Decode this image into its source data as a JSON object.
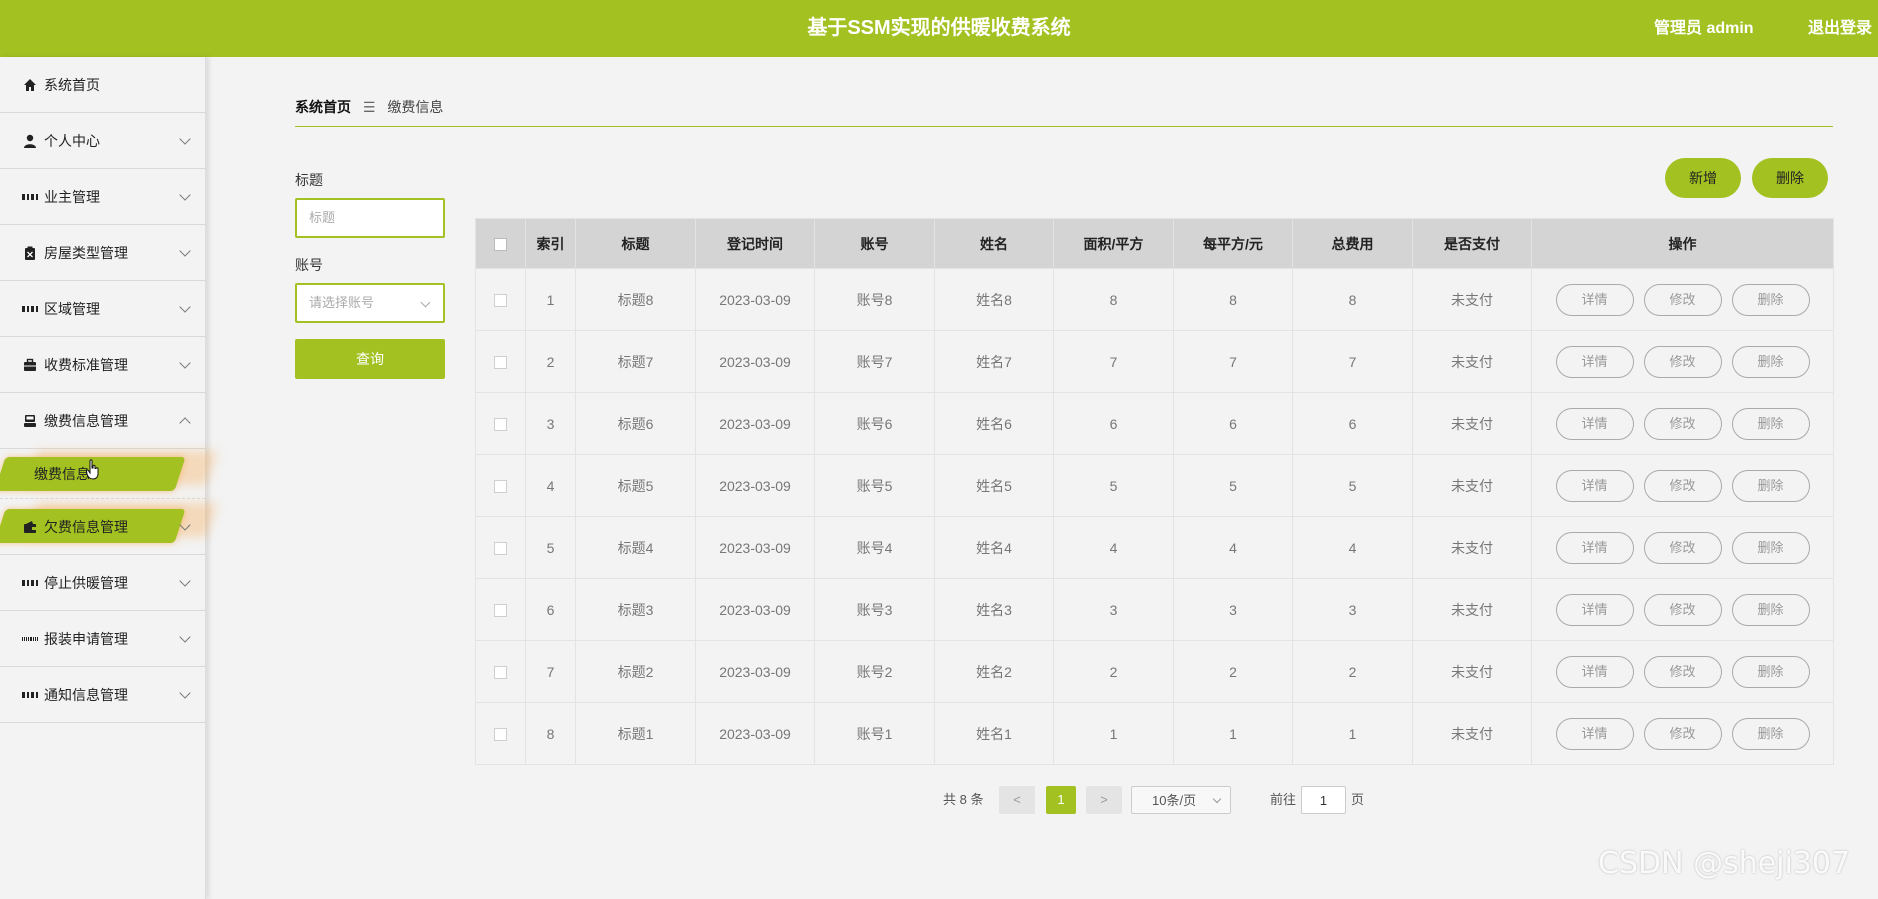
{
  "header": {
    "title": "基于SSM实现的供暖收费系统",
    "user": "管理员 admin",
    "logout": "退出登录"
  },
  "sidebar": {
    "items": [
      {
        "label": "系统首页"
      },
      {
        "label": "个人中心"
      },
      {
        "label": "业主管理"
      },
      {
        "label": "房屋类型管理"
      },
      {
        "label": "区域管理"
      },
      {
        "label": "收费标准管理"
      },
      {
        "label": "缴费信息管理"
      },
      {
        "label": "缴费信息"
      },
      {
        "label": "欠费信息管理"
      },
      {
        "label": "停止供暖管理"
      },
      {
        "label": "报装申请管理"
      },
      {
        "label": "通知信息管理"
      }
    ]
  },
  "breadcrumb": {
    "home": "系统首页",
    "sep": "☰",
    "current": "缴费信息"
  },
  "filter": {
    "title_label": "标题",
    "title_placeholder": "标题",
    "account_label": "账号",
    "account_placeholder": "请选择账号",
    "query_label": "查询"
  },
  "actions": {
    "add": "新增",
    "delete": "删除"
  },
  "table": {
    "headers": [
      "索引",
      "标题",
      "登记时间",
      "账号",
      "姓名",
      "面积/平方",
      "每平方/元",
      "总费用",
      "是否支付",
      "操作"
    ],
    "ops": {
      "detail": "详情",
      "edit": "修改",
      "delete": "删除"
    },
    "rows": [
      {
        "index": "1",
        "title": "标题8",
        "date": "2023-03-09",
        "account": "账号8",
        "name": "姓名8",
        "area": "8",
        "price": "8",
        "total": "8",
        "paid": "未支付"
      },
      {
        "index": "2",
        "title": "标题7",
        "date": "2023-03-09",
        "account": "账号7",
        "name": "姓名7",
        "area": "7",
        "price": "7",
        "total": "7",
        "paid": "未支付"
      },
      {
        "index": "3",
        "title": "标题6",
        "date": "2023-03-09",
        "account": "账号6",
        "name": "姓名6",
        "area": "6",
        "price": "6",
        "total": "6",
        "paid": "未支付"
      },
      {
        "index": "4",
        "title": "标题5",
        "date": "2023-03-09",
        "account": "账号5",
        "name": "姓名5",
        "area": "5",
        "price": "5",
        "total": "5",
        "paid": "未支付"
      },
      {
        "index": "5",
        "title": "标题4",
        "date": "2023-03-09",
        "account": "账号4",
        "name": "姓名4",
        "area": "4",
        "price": "4",
        "total": "4",
        "paid": "未支付"
      },
      {
        "index": "6",
        "title": "标题3",
        "date": "2023-03-09",
        "account": "账号3",
        "name": "姓名3",
        "area": "3",
        "price": "3",
        "total": "3",
        "paid": "未支付"
      },
      {
        "index": "7",
        "title": "标题2",
        "date": "2023-03-09",
        "account": "账号2",
        "name": "姓名2",
        "area": "2",
        "price": "2",
        "total": "2",
        "paid": "未支付"
      },
      {
        "index": "8",
        "title": "标题1",
        "date": "2023-03-09",
        "account": "账号1",
        "name": "姓名1",
        "area": "1",
        "price": "1",
        "total": "1",
        "paid": "未支付"
      }
    ]
  },
  "pagination": {
    "total": "共 8 条",
    "prev": "<",
    "current": "1",
    "next": ">",
    "page_size": "10条/页",
    "goto": "前往",
    "goto_value": "1",
    "page_suffix": "页"
  },
  "watermark": "CSDN @sheji307",
  "colors": {
    "accent": "#a3c121",
    "header_text": "#ffffff",
    "table_header_bg": "#d4d4d4"
  }
}
